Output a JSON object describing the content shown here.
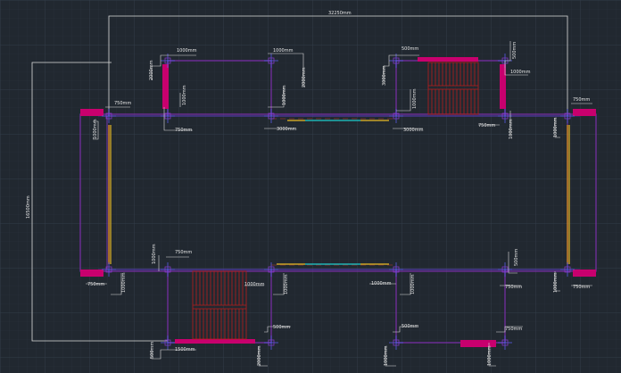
{
  "drawing": {
    "background": "#212830",
    "colors": {
      "grid_minor": "#2a323c",
      "grid_major": "#323b46",
      "wall": "#7a2ea8",
      "wall_light": "#8a3bd0",
      "dim": "#dcdcdc",
      "column": "#c8006e",
      "stair": "#b81d1d",
      "window_yellow": "#c9a227",
      "window_cyan": "#1fb3b3",
      "window_orange": "#d98a2b",
      "axis_red": "#c0392b",
      "center_blue": "#4040d0"
    }
  },
  "dimensions": {
    "overall_width": "32250mm",
    "overall_height": "16500mm",
    "top": {
      "d1": "1000mm",
      "d2": "2000mm",
      "d3": "3000mm",
      "d4": "1000mm",
      "d5": "1000mm",
      "d6": "750mm",
      "d7": "1000mm",
      "d8": "2000mm",
      "d9": "500mm",
      "d10": "1000mm",
      "d11": "3000mm",
      "d12": "1000mm",
      "d13": "500mm",
      "d14": "3000mm",
      "d15": "750mm",
      "d16": "1000mm",
      "d17": "750mm",
      "d18": "1000mm",
      "d19": "750mm",
      "d20": "1000mm"
    },
    "bottom": {
      "b1": "750mm",
      "b2": "1000mm",
      "b3": "750mm",
      "b4": "3000mm",
      "b5": "1000mm",
      "b6": "3000mm",
      "b7": "1000mm",
      "b8": "750mm",
      "b9": "1000mm",
      "b10": "1500mm",
      "b11": "1000mm",
      "b12": "500mm",
      "b13": "2000mm",
      "b14": "500mm",
      "b15": "1000mm",
      "b16": "500mm",
      "b17": "1000mm",
      "b18": "500mm",
      "b19": "1000mm",
      "b20": "750mm",
      "b21": "1000mm",
      "b22": "750mm",
      "b23": "1000mm"
    }
  }
}
